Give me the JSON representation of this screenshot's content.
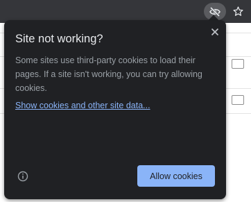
{
  "toolbar": {
    "third_party_cookies_icon": "eye-slash-icon",
    "bookmark_icon": "star-icon"
  },
  "bubble": {
    "title": "Site not working?",
    "body": "Some sites use third-party cookies to load their pages. If a site isn't working, you can try allowing cookies.",
    "link_text": "Show cookies and other site data...",
    "primary_button": "Allow cookies",
    "close_icon": "close-icon",
    "info_icon": "info-icon"
  },
  "colors": {
    "bubble_bg": "#202124",
    "accent": "#8ab4f8",
    "title": "#e8eaed",
    "body": "#9aa0a6"
  }
}
